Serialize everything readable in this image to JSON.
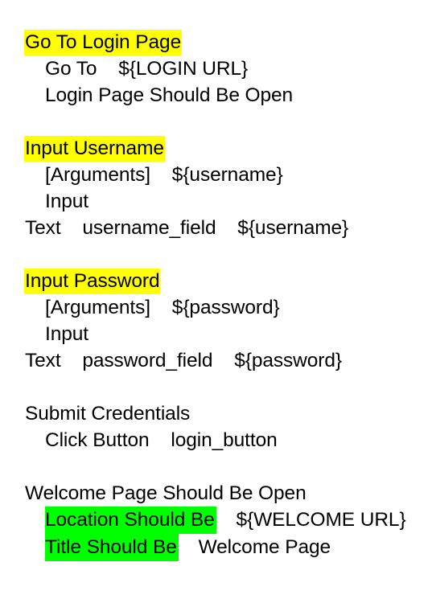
{
  "document": {
    "type": "robot-framework-keyword-listing",
    "background_color": "#ffffff",
    "text_color": "#000000",
    "highlight_colors": {
      "keyword_definition": "#ffff00",
      "assertion_keyword": "#00ff00"
    },
    "blocks": [
      {
        "id": "go-to-login-page",
        "name": "Go To Login Page",
        "name_highlight": "yellow",
        "lines": [
          {
            "text": "Go To    ${LOGIN URL}",
            "indent": true,
            "highlight": "none"
          },
          {
            "text": "Login Page Should Be Open",
            "indent": true,
            "highlight": "none"
          }
        ]
      },
      {
        "id": "input-username",
        "name": "Input Username",
        "name_highlight": "yellow",
        "lines": [
          {
            "text": "[Arguments]    ${username}",
            "indent": true,
            "highlight": "none"
          },
          {
            "text": "Input",
            "indent": true,
            "highlight": "none"
          },
          {
            "text": "Text    username_field    ${username}",
            "indent": false,
            "highlight": "none"
          }
        ]
      },
      {
        "id": "input-password",
        "name": "Input Password",
        "name_highlight": "yellow",
        "lines": [
          {
            "text": "[Arguments]    ${password}",
            "indent": true,
            "highlight": "none"
          },
          {
            "text": "Input",
            "indent": true,
            "highlight": "none"
          },
          {
            "text": "Text    password_field    ${password}",
            "indent": false,
            "highlight": "none"
          }
        ]
      },
      {
        "id": "submit-credentials",
        "name": "Submit Credentials",
        "name_highlight": "none",
        "lines": [
          {
            "text": "Click Button    login_button",
            "indent": true,
            "highlight": "none"
          }
        ]
      },
      {
        "id": "welcome-page-should-be-open",
        "name": "Welcome Page Should Be Open",
        "name_highlight": "none",
        "lines": [
          {
            "keyword": "Location Should Be",
            "argument": "    ${WELCOME URL}",
            "indent": true,
            "highlight": "green"
          },
          {
            "keyword": "Title Should Be",
            "argument": "    Welcome Page",
            "indent": true,
            "highlight": "green"
          }
        ]
      }
    ]
  },
  "lines": {
    "b1_name": "Go To Login Page",
    "b1_l1": "Go To    ${LOGIN URL}",
    "b1_l2": "Login Page Should Be Open",
    "b2_name": "Input Username",
    "b2_l1": "[Arguments]    ${username}",
    "b2_l2": "Input",
    "b2_l3": "Text    username_field    ${username}",
    "b3_name": "Input Password",
    "b3_l1": "[Arguments]    ${password}",
    "b3_l2": "Input",
    "b3_l3": "Text    password_field    ${password}",
    "b4_name": "Submit Credentials",
    "b4_l1": "Click Button    login_button",
    "b5_name": "Welcome Page Should Be Open",
    "b5_l1_kw": "Location Should Be",
    "b5_l1_arg": "    ${WELCOME URL}",
    "b5_l2_kw": "Title Should Be",
    "b5_l2_arg": "    Welcome Page"
  }
}
